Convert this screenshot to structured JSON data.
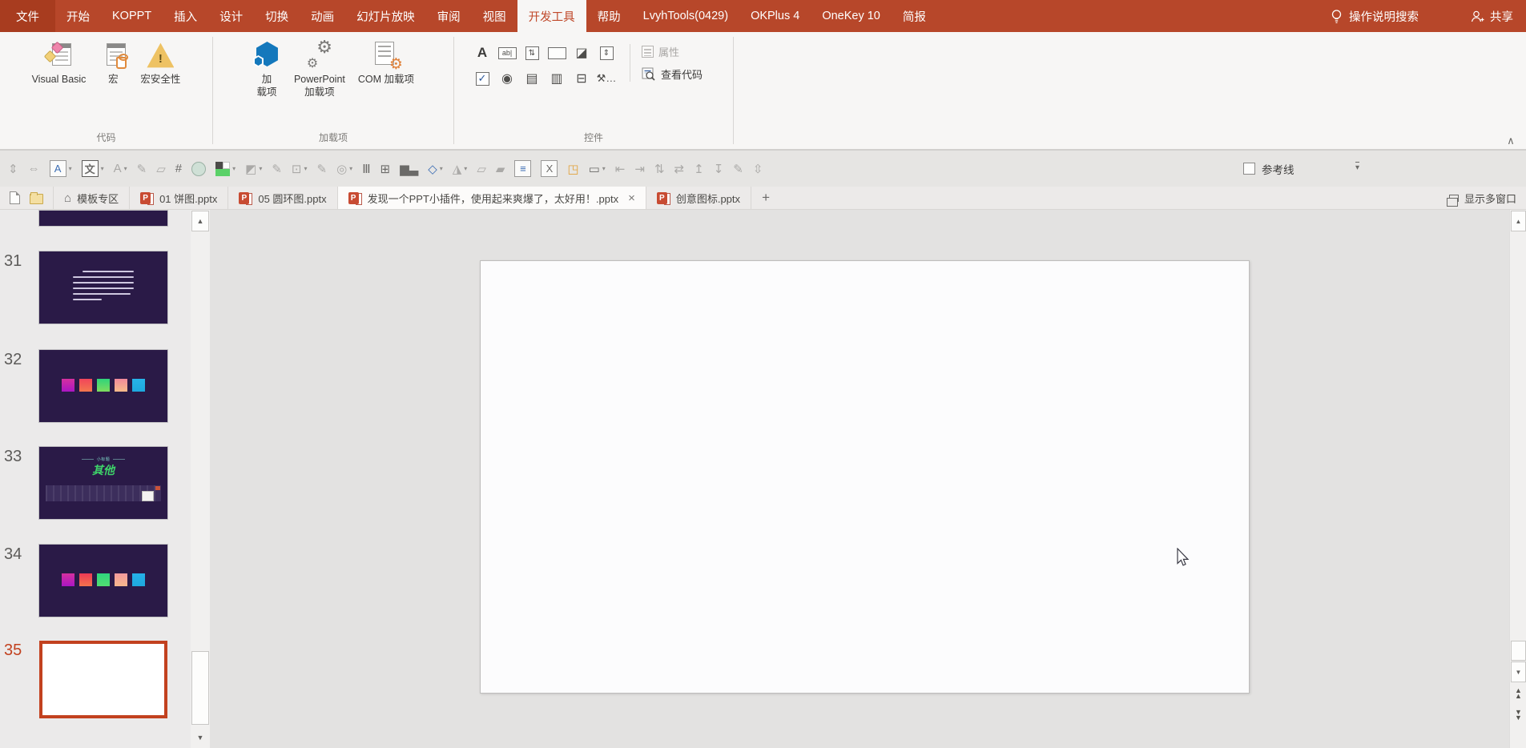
{
  "app": {
    "search_label": "操作说明搜索",
    "share_label": "共享"
  },
  "menubar": {
    "tabs": [
      {
        "label": "文件",
        "file": true
      },
      {
        "label": "开始"
      },
      {
        "label": "KOPPT"
      },
      {
        "label": "插入"
      },
      {
        "label": "设计"
      },
      {
        "label": "切换"
      },
      {
        "label": "动画"
      },
      {
        "label": "幻灯片放映"
      },
      {
        "label": "审阅"
      },
      {
        "label": "视图"
      },
      {
        "label": "开发工具",
        "active": true
      },
      {
        "label": "帮助"
      },
      {
        "label": "LvyhTools(0429)"
      },
      {
        "label": "OKPlus 4"
      },
      {
        "label": "OneKey 10"
      },
      {
        "label": "简报"
      }
    ]
  },
  "ribbon": {
    "groups": [
      {
        "label": "代码"
      },
      {
        "label": "加载项"
      },
      {
        "label": "控件"
      }
    ],
    "code_buttons": [
      {
        "label": "Visual Basic"
      },
      {
        "label": "宏"
      },
      {
        "label": "宏安全性"
      }
    ],
    "addin_buttons": [
      {
        "label": "加\n载项"
      },
      {
        "label": "PowerPoint\n加载项"
      },
      {
        "label": "COM 加载项"
      }
    ],
    "properties_label": "属性",
    "view_code_label": "查看代码",
    "controls": [
      {
        "n": "label-control",
        "g": "A",
        "cls": "big"
      },
      {
        "n": "textbox-control",
        "g": "ab|",
        "cls": "boxed wide"
      },
      {
        "n": "spin-button-control",
        "g": "⇅",
        "cls": "boxed"
      },
      {
        "n": "command-button-control",
        "g": "",
        "cls": "boxed wide"
      },
      {
        "n": "image-control",
        "g": "◪",
        "cls": "plain"
      },
      {
        "n": "scrollbar-control",
        "g": "⇕",
        "cls": "boxed"
      },
      {
        "n": "checkbox-control",
        "g": "✓",
        "cls": "check"
      },
      {
        "n": "option-button-control",
        "g": "◉",
        "cls": "plain"
      },
      {
        "n": "listbox-control",
        "g": "▤",
        "cls": "plain"
      },
      {
        "n": "combobox-control",
        "g": "▥",
        "cls": "plain"
      },
      {
        "n": "toggle-button-control",
        "g": "⊟",
        "cls": "plain"
      },
      {
        "n": "more-controls",
        "g": "⚒…",
        "cls": ""
      }
    ]
  },
  "toolbar": {
    "guides_label": "参考线",
    "icons": [
      {
        "n": "distribute-vertical-icon",
        "g": "⇕",
        "cls": "dim"
      },
      {
        "n": "distribute-horizontal-icon",
        "g": "⇔",
        "cls": "dim"
      },
      {
        "n": "text-style-box-icon",
        "g": "A",
        "cls": "boxed blue",
        "dd": true
      },
      {
        "n": "font-wen-icon",
        "g": "文",
        "cls": "boxed dark sel",
        "dd": true
      },
      {
        "n": "font-color-icon",
        "g": "A",
        "cls": "dim",
        "dd": true
      },
      {
        "n": "eyedropper-icon",
        "g": "✎",
        "cls": "dim"
      },
      {
        "n": "paste-picture-icon",
        "g": "▱",
        "cls": "dim"
      },
      {
        "n": "crop-marks-icon",
        "g": "#",
        "cls": "dark"
      },
      {
        "n": "ellipse-icon",
        "g": "",
        "cls": "ellipse"
      },
      {
        "n": "color-swatch-icon",
        "g": "",
        "cls": "swatch",
        "dd": true
      },
      {
        "n": "ink-bucket-icon",
        "g": "◩",
        "cls": "dim",
        "dd": true
      },
      {
        "n": "eyedropper2-icon",
        "g": "✎",
        "cls": "dim"
      },
      {
        "n": "edit-shape-icon",
        "g": "⊡",
        "cls": "dim",
        "dd": true
      },
      {
        "n": "eyedropper3-icon",
        "g": "✎",
        "cls": "dim"
      },
      {
        "n": "merge-shapes-icon",
        "g": "◎",
        "cls": "dim",
        "dd": true
      },
      {
        "n": "columns-icon",
        "g": "Ⅲ",
        "cls": "dark"
      },
      {
        "n": "table-edit-icon",
        "g": "⊞",
        "cls": "dark"
      },
      {
        "n": "bar-chart-icon",
        "g": "▆▃",
        "cls": "dark"
      },
      {
        "n": "shapes-icon",
        "g": "◇",
        "cls": "blue",
        "dd": true
      },
      {
        "n": "flip-icon",
        "g": "◮",
        "cls": "dim",
        "dd": true
      },
      {
        "n": "overlap-squares-icon",
        "g": "▱",
        "cls": "dim"
      },
      {
        "n": "group-squares-icon",
        "g": "▰",
        "cls": "dim"
      },
      {
        "n": "text-lines-icon",
        "g": "≡",
        "cls": "boxed blue"
      },
      {
        "n": "excel-icon",
        "g": "X",
        "cls": "boxed dark"
      },
      {
        "n": "select-shapes-icon",
        "g": "◳",
        "cls": "orange"
      },
      {
        "n": "border-box-icon",
        "g": "▭",
        "cls": "dark",
        "dd": true
      },
      {
        "n": "send-left-icon",
        "g": "⇤",
        "cls": "dim"
      },
      {
        "n": "send-right-icon",
        "g": "⇥",
        "cls": "dim"
      },
      {
        "n": "align-stack-icon",
        "g": "⇅",
        "cls": "dim"
      },
      {
        "n": "swap-picture-icon",
        "g": "⇄",
        "cls": "dim"
      },
      {
        "n": "move-up-icon",
        "g": "↥",
        "cls": "dim"
      },
      {
        "n": "move-down-icon",
        "g": "↧",
        "cls": "dim"
      },
      {
        "n": "format-brush-icon",
        "g": "✎",
        "cls": "dim"
      },
      {
        "n": "resize-height-icon",
        "g": "⇳",
        "cls": "dim"
      }
    ]
  },
  "tabbar": {
    "multi_window_label": "显示多窗口",
    "new_tab_label": "+",
    "tabs": [
      {
        "label": "模板专区",
        "icon": "home"
      },
      {
        "label": "01 饼图.pptx",
        "icon": "ppt"
      },
      {
        "label": "05 圆环图.pptx",
        "icon": "ppt"
      },
      {
        "label": "发现一个PPT小插件，使用起来爽爆了，太好用！.pptx",
        "icon": "ppt",
        "active": true,
        "close": "×"
      },
      {
        "label": "创意图标.pptx",
        "icon": "ppt"
      }
    ]
  },
  "sidebar": {
    "slides": [
      {
        "num": "",
        "type": "partial"
      },
      {
        "num": "31",
        "type": "text"
      },
      {
        "num": "32",
        "type": "squares",
        "palette": "p32"
      },
      {
        "num": "33",
        "type": "qita"
      },
      {
        "num": "34",
        "type": "squares",
        "palette": "p34"
      },
      {
        "num": "35",
        "type": "blank",
        "selected": true
      }
    ],
    "palettes": {
      "p32": [
        [
          "#d5309f",
          "#ab16c4"
        ],
        [
          "#f1455b",
          "#f3774e"
        ],
        [
          "#2fd47b",
          "#7edc5e"
        ],
        [
          "#f0899b",
          "#f6bb8b"
        ],
        [
          "#27b4e9",
          "#1ea8de"
        ]
      ],
      "p34": [
        [
          "#d5309f",
          "#ab16c4"
        ],
        [
          "#ee3a55",
          "#f3734d"
        ],
        [
          "#2fd57e",
          "#52dd71"
        ],
        [
          "#f29a9d",
          "#f6b78d"
        ],
        [
          "#25b1e8",
          "#1ea8de"
        ]
      ]
    },
    "qita": {
      "subtitle": "小标题",
      "title": "其他",
      "title_color": "#3ed469"
    }
  },
  "colors": {
    "brand_red": "#b7472a",
    "selection_red": "#c2411f",
    "thumb_bg": "#2a1a47",
    "slide_bg": "#fcfcfd"
  }
}
